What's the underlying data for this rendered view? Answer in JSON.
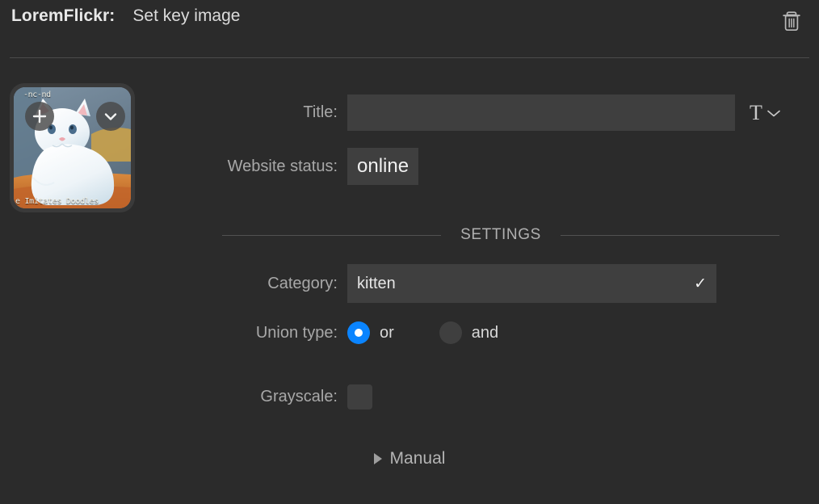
{
  "header": {
    "app_name": "LoremFlickr:",
    "action_title": "Set key image",
    "delete_icon": "trash-icon"
  },
  "thumbnail": {
    "overlay_top": "-nc-nd",
    "overlay_bottom": "e Imitates Doodles",
    "add_icon": "plus-icon",
    "menu_icon": "chevron-down-icon",
    "alt": "white kitten watercolor painting"
  },
  "form": {
    "title": {
      "label": "Title:",
      "value": "",
      "placeholder": "",
      "type_icon_letter": "T",
      "type_icon": "text-style-chevron-down-icon"
    },
    "website_status": {
      "label": "Website status:",
      "value": "online"
    }
  },
  "settings": {
    "section_label": "SETTINGS",
    "category": {
      "label": "Category:",
      "value": "kitten",
      "placeholder": "",
      "confirm_icon": "checkmark-icon"
    },
    "union_type": {
      "label": "Union type:",
      "options": [
        {
          "label": "or",
          "selected": true
        },
        {
          "label": "and",
          "selected": false
        }
      ]
    },
    "grayscale": {
      "label": "Grayscale:",
      "checked": false
    }
  },
  "manual": {
    "label": "Manual",
    "expanded": false,
    "disclosure_icon": "triangle-right-icon"
  },
  "colors": {
    "background": "#2b2b2b",
    "field": "#3f3f3f",
    "accent": "#0a84ff",
    "label_text": "#a8a8a8",
    "value_text": "#e6e6e6",
    "divider": "#4a4a4a"
  }
}
